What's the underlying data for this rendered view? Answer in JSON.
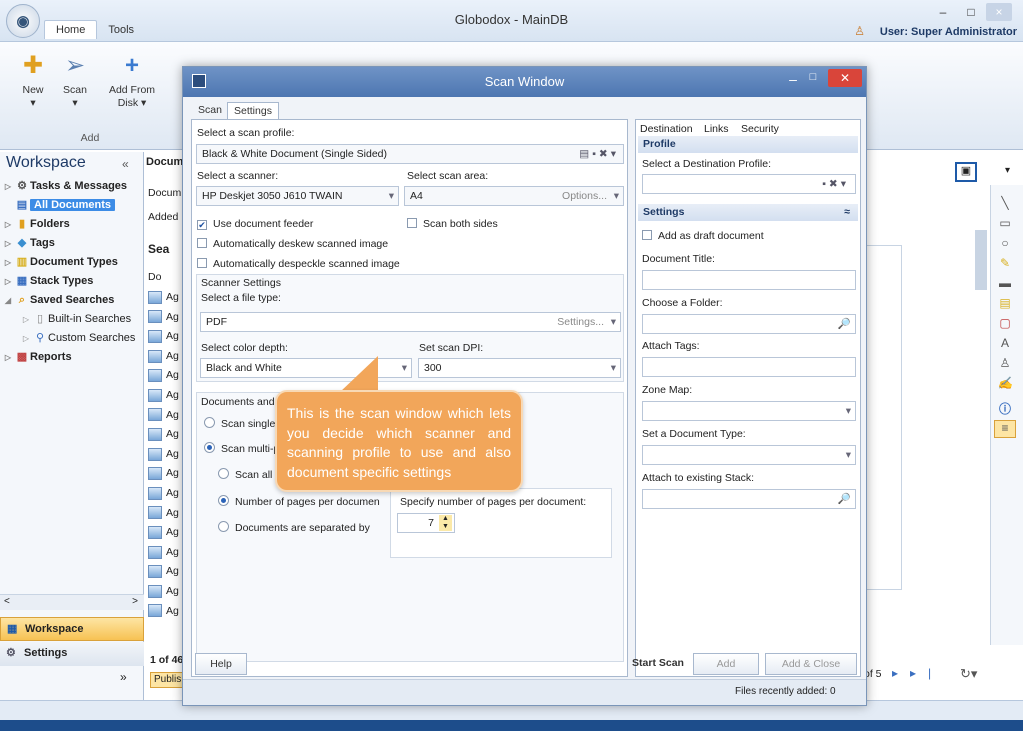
{
  "app": {
    "title": "Globodox - MainDB",
    "logo": "globodox-logo",
    "user": "User: Super Administrator"
  },
  "ribbon": {
    "tabs": [
      "Home",
      "Tools"
    ],
    "buttons": [
      {
        "label": "New",
        "sub": "▾",
        "icon": "new-doc-icon"
      },
      {
        "label": "Scan",
        "sub": "▾",
        "icon": "scan-icon"
      },
      {
        "label": "Add From",
        "sub": "Disk ▾",
        "icon": "add-icon"
      }
    ],
    "group": "Add"
  },
  "sidebar": {
    "title": "Workspace",
    "collapse": "«",
    "items": [
      {
        "label": "Tasks & Messages",
        "bold": true,
        "icon": "gear-icon",
        "arrow": "▷"
      },
      {
        "label": "All Documents",
        "bold": true,
        "selected": true,
        "icon": "documents-icon",
        "arrow": ""
      },
      {
        "label": "Folders",
        "bold": true,
        "icon": "folder-icon",
        "arrow": "▷"
      },
      {
        "label": "Tags",
        "bold": true,
        "icon": "tag-icon",
        "arrow": "▷"
      },
      {
        "label": "Document Types",
        "bold": true,
        "icon": "doc-types-icon",
        "arrow": "▷"
      },
      {
        "label": "Stack Types",
        "bold": true,
        "icon": "stack-icon",
        "arrow": "▷"
      },
      {
        "label": "Saved Searches",
        "bold": true,
        "icon": "search-folder-icon",
        "arrow": "◢"
      },
      {
        "label": "Built-in Searches",
        "bold": false,
        "icon": "page-icon",
        "arrow": "▷"
      },
      {
        "label": "Custom Searches",
        "bold": false,
        "icon": "search-icon",
        "arrow": "▷"
      },
      {
        "label": "Reports",
        "bold": true,
        "icon": "reports-icon",
        "arrow": "▷"
      }
    ],
    "nav_workspace": "Workspace",
    "nav_settings": "Settings",
    "more": "»"
  },
  "doclist": {
    "header": "Docum",
    "rows": [
      "Docum",
      "Added I",
      "Sea",
      "Do",
      "Ag",
      "Ag",
      "Ag",
      "Ag",
      "Ag",
      "Ag",
      "Ag",
      "Ag",
      "Ag",
      "Ag",
      "Ag",
      "Ag",
      "Ag",
      "Ag",
      "Ag",
      "Ag",
      "Ag"
    ],
    "footer": "1 of 46",
    "publish": "Publis"
  },
  "pager": {
    "text": "of 5"
  },
  "scan": {
    "title": "Scan Window",
    "tabs": [
      "Scan",
      "Settings"
    ],
    "profile_label": "Select a scan profile:",
    "profile_value": "Black & White Document (Single Sided)",
    "scanner_label": "Select a scanner:",
    "scanner_value": "HP Deskjet 3050 J610 TWAIN",
    "area_label": "Select scan area:",
    "area_value": "A4",
    "options_label": "Options...",
    "feeder": "Use document feeder",
    "both_sides": "Scan both sides",
    "deskew": "Automatically deskew scanned image",
    "despeckle": "Automatically despeckle scanned image",
    "scanner_settings": "Scanner Settings",
    "file_type_label": "Select a file type:",
    "file_type_value": "PDF",
    "settings_btn": "Settings...",
    "color_label": "Select color depth:",
    "color_value": "Black and White",
    "dpi_label": "Set scan DPI:",
    "dpi_value": "300",
    "docs_group": "Documents and P",
    "scan_single": "Scan single p",
    "scan_multi": "Scan multi-pa",
    "scan_all": "Scan all p",
    "num_pages": "Number of pages per documen",
    "separated": "Documents are separated by",
    "specify_label": "Specify number of pages per document:",
    "specify_value": "7",
    "help": "Help",
    "start": "Start Scan",
    "add": "Add",
    "add_close": "Add & Close",
    "status": "Files recently added: 0"
  },
  "dest": {
    "tabs": [
      "Destination",
      "Links",
      "Security"
    ],
    "profile_section": "Profile",
    "dest_profile_label": "Select a Destination Profile:",
    "settings_section": "Settings",
    "draft": "Add as draft document",
    "doc_title": "Document Title:",
    "folder": "Choose a Folder:",
    "tags": "Attach Tags:",
    "zone": "Zone Map:",
    "doctype": "Set a Document Type:",
    "stack": "Attach to existing Stack:"
  },
  "callout": {
    "text": "This is the scan window which lets you decide which scanner and scanning profile to use and also document specific settings"
  },
  "colors": {
    "accent": "#3c8ce6",
    "callout": "#f2a65a",
    "title_bar": "#4d76b1",
    "close": "#d9453a"
  }
}
